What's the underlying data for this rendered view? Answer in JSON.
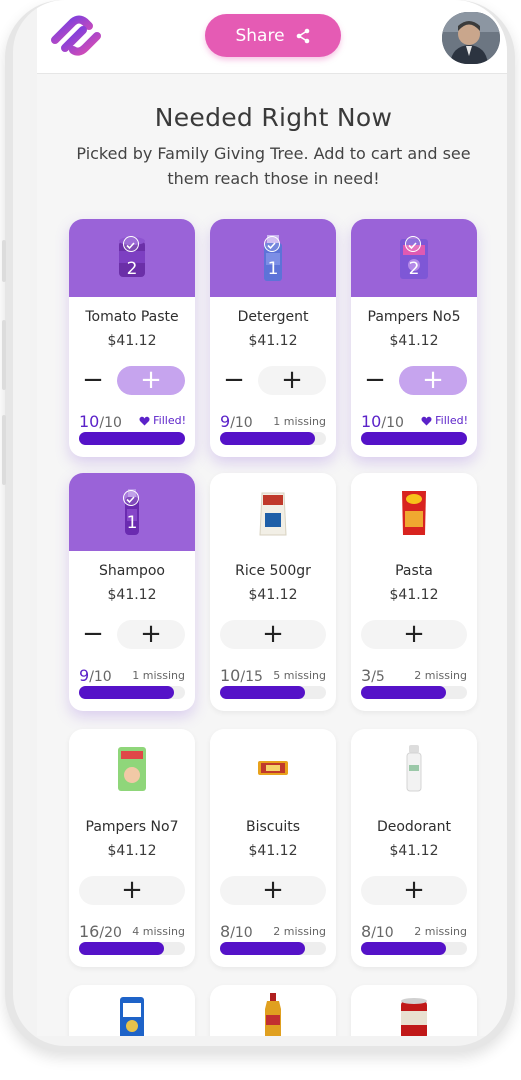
{
  "header": {
    "share_label": "Share"
  },
  "page": {
    "title": "Needed Right Now",
    "subtitle": "Picked  by Family Giving Tree. Add to cart and see them reach those in need!"
  },
  "products": [
    {
      "name": "Tomato Paste",
      "price": "$41.12",
      "have": "10",
      "need": "/10",
      "status": "Filled!",
      "qty": "2",
      "icon": "tomato-can-icon",
      "selected": true,
      "fraction": 1.0
    },
    {
      "name": "Detergent",
      "price": "$41.12",
      "have": "9",
      "need": "/10",
      "status": "1 missing",
      "qty": "1",
      "icon": "detergent-bottle-icon",
      "selected": true,
      "fraction": 0.9
    },
    {
      "name": "Pampers No5",
      "price": "$41.12",
      "have": "10",
      "need": "/10",
      "status": "Filled!",
      "qty": "2",
      "icon": "diaper-pack-icon",
      "selected": true,
      "fraction": 1.0
    },
    {
      "name": "Shampoo",
      "price": "$41.12",
      "have": "9",
      "need": "/10",
      "status": "1 missing",
      "qty": "1",
      "icon": "shampoo-bottle-icon",
      "selected": true,
      "fraction": 0.9
    },
    {
      "name": "Rice 500gr",
      "price": "$41.12",
      "have": "10",
      "need": "/15",
      "status": "5 missing",
      "qty": "",
      "icon": "rice-bag-icon",
      "selected": false,
      "fraction": 0.8
    },
    {
      "name": "Pasta",
      "price": "$41.12",
      "have": "3",
      "need": "/5",
      "status": "2 missing",
      "qty": "",
      "icon": "pasta-pack-icon",
      "selected": false,
      "fraction": 0.8
    },
    {
      "name": "Pampers No7",
      "price": "$41.12",
      "have": "16",
      "need": "/20",
      "status": "4 missing",
      "qty": "",
      "icon": "baby-diaper-icon",
      "selected": false,
      "fraction": 0.8
    },
    {
      "name": "Biscuits",
      "price": "$41.12",
      "have": "8",
      "need": "/10",
      "status": "2 missing",
      "qty": "",
      "icon": "biscuit-pack-icon",
      "selected": false,
      "fraction": 0.8
    },
    {
      "name": "Deodorant",
      "price": "$41.12",
      "have": "8",
      "need": "/10",
      "status": "2 missing",
      "qty": "",
      "icon": "deodorant-can-icon",
      "selected": false,
      "fraction": 0.8
    }
  ],
  "colors": {
    "accent": "#5512c8",
    "selected_bg": "#9a63d8",
    "share": "#e55bb4"
  }
}
